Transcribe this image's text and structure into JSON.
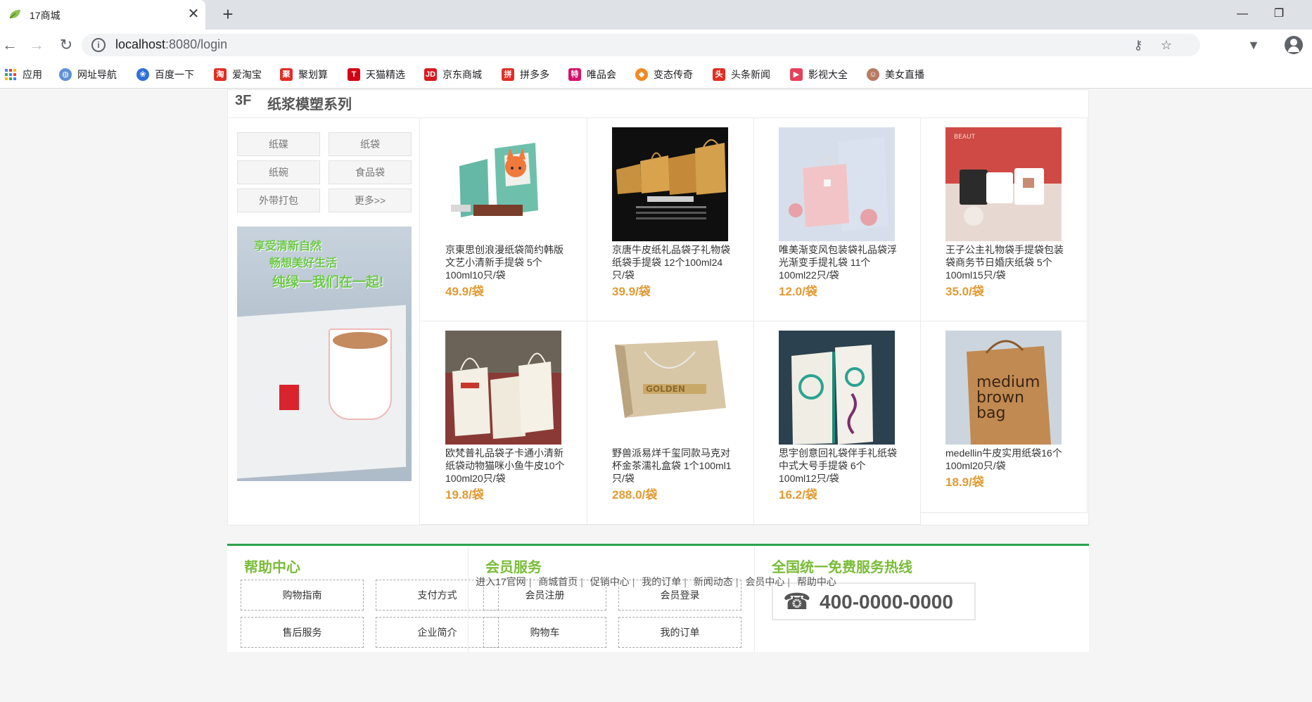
{
  "browser": {
    "tab_title": "17商城",
    "url_host": "localhost",
    "url_path": ":8080/login",
    "bookmarks": [
      {
        "label": "应用",
        "icon": "apps-grid-icon",
        "color": "#4285f4"
      },
      {
        "label": "网址导航",
        "icon": "globe-icon",
        "color": "#5f8fd6"
      },
      {
        "label": "百度一下",
        "icon": "baidu-paw-icon",
        "color": "#2f6fd9"
      },
      {
        "label": "爱淘宝",
        "icon": "taobao-icon",
        "color": "#e02e24"
      },
      {
        "label": "聚划算",
        "icon": "juhuasuan-icon",
        "color": "#e02e24"
      },
      {
        "label": "天猫精选",
        "icon": "tmall-icon",
        "color": "#d40015"
      },
      {
        "label": "京东商城",
        "icon": "jd-icon",
        "color": "#d71921"
      },
      {
        "label": "拼多多",
        "icon": "pinduoduo-icon",
        "color": "#e02e24"
      },
      {
        "label": "唯品会",
        "icon": "vipshop-icon",
        "color": "#d6116b"
      },
      {
        "label": "变态传奇",
        "icon": "game-icon",
        "color": "#f08a24"
      },
      {
        "label": "头条新闻",
        "icon": "toutiao-icon",
        "color": "#e02e24"
      },
      {
        "label": "影视大全",
        "icon": "video-icon",
        "color": "#e63f5a"
      },
      {
        "label": "美女直播",
        "icon": "live-icon",
        "color": "#b97a62"
      }
    ]
  },
  "floor": {
    "number": "3F",
    "title": "纸浆模塑系列",
    "categories": [
      "纸碟",
      "纸袋",
      "纸碗",
      "食品袋",
      "外带打包",
      "更多>>"
    ],
    "promo_lines": [
      "享受清新自然",
      "畅想美好生活",
      "纯绿一我们在一起!"
    ],
    "products": [
      {
        "name": "京東思创浪漫纸袋简约韩版文艺小清新手提袋 5个100ml10只/袋",
        "price": "49.9/袋",
        "img": "fox-gift-bag"
      },
      {
        "name": "京唐牛皮纸礼品袋子礼物袋纸袋手提袋 12个100ml24只/袋",
        "price": "39.9/袋",
        "img": "kraft-bags-black"
      },
      {
        "name": "唯美渐变风包装袋礼品袋浮光渐变手提礼袋 11个100ml22只/袋",
        "price": "12.0/袋",
        "img": "pink-gradient-bags"
      },
      {
        "name": "王子公主礼物袋手提袋包装袋商务节日婚庆纸袋 5个100ml15只/袋",
        "price": "35.0/袋",
        "img": "cups-red-bg"
      },
      {
        "name": "欧梵普礼品袋子卡通小清新纸袋动物猫咪小鱼牛皮10个100ml20只/袋",
        "price": "19.8/袋",
        "img": "white-bags"
      },
      {
        "name": "野兽派易烊千玺同款马克对杯金茶濡礼盒袋 1个100ml1只/袋",
        "price": "288.0/袋",
        "img": "golden-bag"
      },
      {
        "name": "思宇创意回礼袋伴手礼纸袋中式大号手提袋 6个100ml12只/袋",
        "price": "16.2/袋",
        "img": "chinese-bags"
      },
      {
        "name": "medellin牛皮实用纸袋16个100ml20只/袋",
        "price": "18.9/袋",
        "img": "medium-brown-bag"
      }
    ]
  },
  "service": {
    "help": {
      "title": "帮助中心",
      "items": [
        "购物指南",
        "支付方式",
        "售后服务",
        "企业简介"
      ]
    },
    "member": {
      "title": "会员服务",
      "items": [
        "会员注册",
        "会员登录",
        "购物车",
        "我的订单"
      ]
    },
    "hotline": {
      "title": "全国统一免费服务热线",
      "number": "400-0000-0000",
      "icon": "phone-icon"
    }
  },
  "bottom_links": [
    "进入17官网",
    "商城首页",
    "促销中心",
    "我的订单",
    "新闻动态",
    "会员中心",
    "帮助中心"
  ],
  "colors": {
    "accent_green": "#2aa24b",
    "title_green": "#79bd37",
    "price_orange": "#e29a33"
  }
}
